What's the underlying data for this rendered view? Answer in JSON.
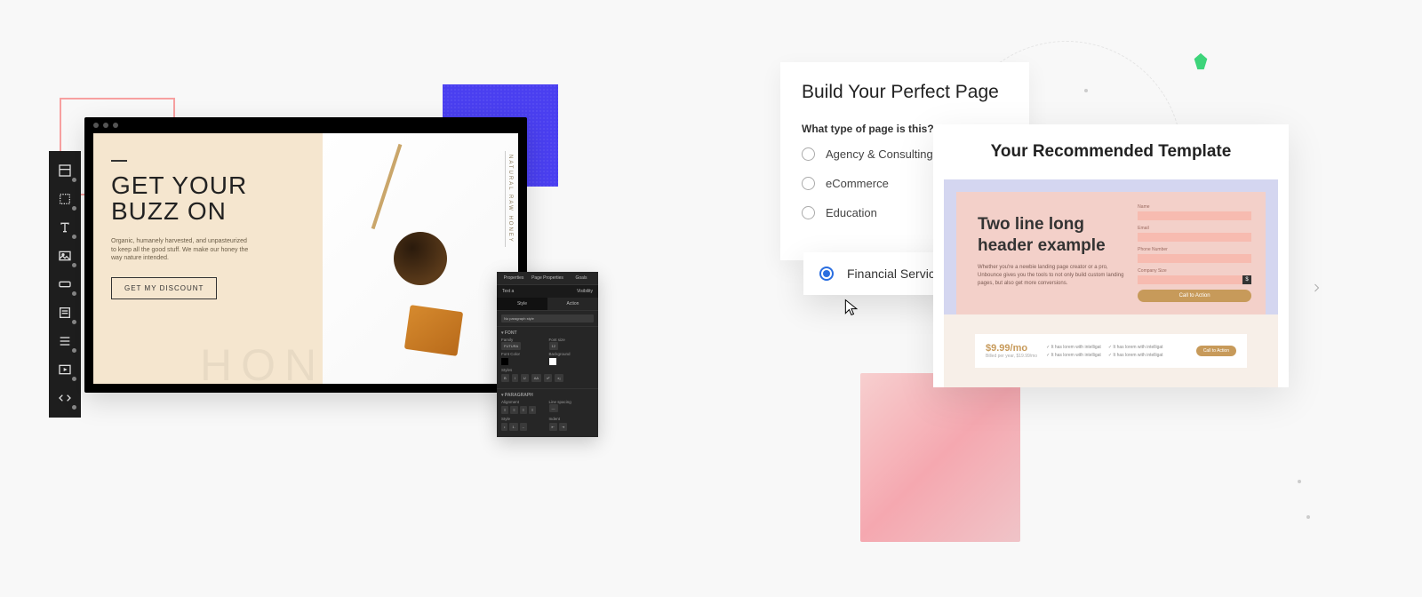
{
  "left": {
    "headline_line1": "GET YOUR",
    "headline_line2": "BUZZ ON",
    "body": "Organic, humanely harvested, and unpasteurized to keep all the good stuff. We make our honey the way nature intended.",
    "cta": "GET MY DISCOUNT",
    "ghost": "HONEY",
    "vertical_tag": "NATURAL RAW HONEY",
    "props": {
      "tabs": {
        "properties": "Properties",
        "page_properties": "Page Properties",
        "goals": "Goals"
      },
      "element": "Text a",
      "visibility": "Visibility",
      "subtabs": {
        "style": "Style",
        "action": "Action"
      },
      "placeholder": "No paragraph style",
      "section_font": "FONT",
      "labels": {
        "family": "Family",
        "font_size": "Font size",
        "font_color": "Font Color",
        "background": "Background",
        "styles": "Styles"
      },
      "family_value": "FUTURA",
      "size_value": "12",
      "section_paragraph": "PARAGRAPH",
      "labels2": {
        "alignment": "Alignment",
        "line_spacing": "Line spacing",
        "style": "Style",
        "indent": "Indent"
      }
    }
  },
  "right": {
    "build_title": "Build Your Perfect Page",
    "question": "What type of page is this?",
    "options": [
      "Agency & Consulting",
      "eCommerce",
      "Education"
    ],
    "selected": "Financial Services",
    "template_title": "Your Recommended Template",
    "hero_heading": "Two line long header example",
    "hero_body": "Whether you're a newbie landing page creator or a pro, Unbounce gives you the tools to not only build custom landing pages, but also get more conversions.",
    "form": {
      "labels": {
        "name": "Name",
        "email": "Email",
        "phone": "Phone Number",
        "company": "Company Size"
      },
      "cta": "Call to Action"
    },
    "price": "$9.99/mo",
    "price_sub": "Billed per year, $19.99/mo",
    "features": [
      "It has lorem with intelligat",
      "It has lorem with intelligat",
      "It has lorem with intelligat",
      "It has lorem with intelligat"
    ],
    "price_cta": "Call to Action"
  }
}
